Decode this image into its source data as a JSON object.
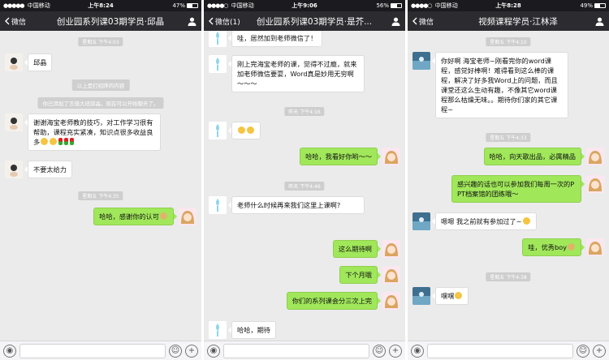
{
  "panels": [
    {
      "status": {
        "carrier": "中国移动",
        "time": "上午8:24",
        "battery": "47%",
        "battery_level": 0.47
      },
      "nav": {
        "back": "微信",
        "title": "创业园系列课03期学员·邱晶"
      },
      "messages": {
        "t1": "星期五 下午4:03",
        "m1": "邱晶",
        "s1": "以上是打招呼的内容",
        "s2": "你已添加了言值大班邱晶，现在可以开始聊天了。",
        "m2": "谢谢海宝老师教的技巧，对工作学习很有帮助，课程充实紧凑，知识点很多收益良多",
        "m3": "不要太给力",
        "t2": "星期五 下午4:35",
        "m4": "哈哈，感谢你的认可"
      }
    },
    {
      "status": {
        "carrier": "中国移动",
        "time": "上午9:06",
        "battery": "56%",
        "battery_level": 0.56
      },
      "nav": {
        "back": "微信(1)",
        "title": "创业园系列课03期学员·是芥..."
      },
      "messages": {
        "m1": "哇，居然加到老师微信了！",
        "m2": "刚上完海宝老师的课，觉得不过瘾，就来加老师微信要耍，Word真是妙用无穷啊～～～",
        "t1": "昨天 下午4:16",
        "m3": "",
        "m4": "哈哈，我看好你哟～～",
        "t2": "昨天 下午4:46",
        "m5": "老师什么时候再来我们这里上课啊?",
        "m6": "这么期待啊",
        "m7": "下个月哦",
        "m8": "你们的系列课会分三次上完",
        "m9": "哈哈，期待"
      }
    },
    {
      "status": {
        "carrier": "中国移动",
        "time": "上午8:28",
        "battery": "49%",
        "battery_level": 0.49
      },
      "nav": {
        "back": "微信",
        "title": "视频课程学员·江林泽"
      },
      "messages": {
        "t1": "星期五 下午4:10",
        "m1": "你好啊 海宝老师~刚看完你的word课程，感觉好棒啊！难得看到这么棒的课程，解决了好多我Word上的问题，而且课堂还这么生动有趣，不像其它word课程那么枯燥无味。。期待你们家的其它课程~",
        "t2": "星期五 下午4:33",
        "m2": "哈哈，向天歌出品，必属精品",
        "m3": "感兴趣的话也可以参加我们每周一次的PPT档案馆的团练哦～",
        "m4": "嗯嗯 我之前就有参加过了~",
        "m5": "哇，优秀boy",
        "t3": "星期五 下午4:38",
        "m6": "嘿嘿"
      }
    }
  ],
  "colors": {
    "nav_bg": "#2b2b30",
    "status_bg": "#1b1b1f",
    "chat_bg": "#ebebeb",
    "out_bubble": "#a0e75a"
  },
  "icons": [
    "back-chevron-icon",
    "person-icon",
    "voice-icon",
    "emoji-icon",
    "plus-icon",
    "signal-icon",
    "wifi-icon",
    "battery-icon"
  ]
}
